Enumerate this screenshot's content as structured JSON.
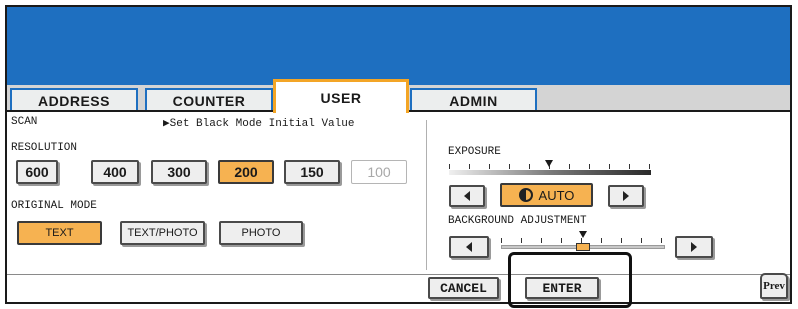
{
  "tabs": [
    {
      "label": "ADDRESS",
      "active": false
    },
    {
      "label": "COUNTER",
      "active": false
    },
    {
      "label": "USER",
      "active": true
    },
    {
      "label": "ADMIN",
      "active": false
    }
  ],
  "section": {
    "title": "SCAN",
    "subtitle": "▶Set Black Mode Initial Value"
  },
  "resolution": {
    "label": "RESOLUTION",
    "options": [
      "600",
      "400",
      "300",
      "200",
      "150",
      "100"
    ],
    "selected": "200",
    "disabled": [
      "100"
    ]
  },
  "original_mode": {
    "label": "ORIGINAL MODE",
    "options": [
      "TEXT",
      "TEXT/PHOTO",
      "PHOTO"
    ],
    "selected": "TEXT"
  },
  "exposure": {
    "label": "EXPOSURE",
    "auto_label": "AUTO",
    "auto_selected": true,
    "auto_icon": "half-circle-icon"
  },
  "background_adjustment": {
    "label": "BACKGROUND ADJUSTMENT",
    "level_fraction": 0.5
  },
  "footer": {
    "cancel_label": "CANCEL",
    "enter_label": "ENTER",
    "prev_label": "Prev"
  },
  "colors": {
    "banner": "#1e6fc0",
    "accent_orange": "#f3a526",
    "selected_fill": "#f6b251"
  }
}
